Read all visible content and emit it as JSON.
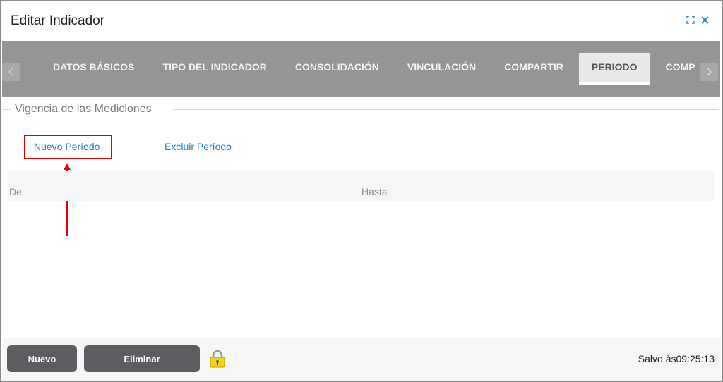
{
  "dialog": {
    "title": "Editar Indicador"
  },
  "tabs": [
    {
      "label": "DATOS BÁSICOS",
      "active": false
    },
    {
      "label": "TIPO DEL INDICADOR",
      "active": false
    },
    {
      "label": "CONSOLIDACIÓN",
      "active": false
    },
    {
      "label": "VINCULACIÓN",
      "active": false
    },
    {
      "label": "COMPARTIR",
      "active": false
    },
    {
      "label": "PERIODO",
      "active": true
    },
    {
      "label": "COMP",
      "active": false
    }
  ],
  "section": {
    "legend": "Vigencia de las Mediciones",
    "actions": {
      "new_period": "Nuevo Período",
      "exclude_period": "Excluir Período"
    },
    "grid": {
      "columns": [
        "De",
        "Hasta"
      ]
    }
  },
  "footer": {
    "new_label": "Nuevo",
    "delete_label": "Eliminar",
    "saved_text": "Salvo às09:25:13"
  },
  "colors": {
    "tabbar": "#959595",
    "active_tab": "#e9e9e9",
    "link": "#1f7fcc",
    "highlight": "#e60000",
    "button": "#5b5d61"
  },
  "icons": {
    "maximize": "maximize-icon",
    "close": "close-icon",
    "scroll_left": "chevron-left-icon",
    "scroll_right": "chevron-right-icon",
    "lock": "lock-icon",
    "annotation": "red-arrow-icon"
  }
}
